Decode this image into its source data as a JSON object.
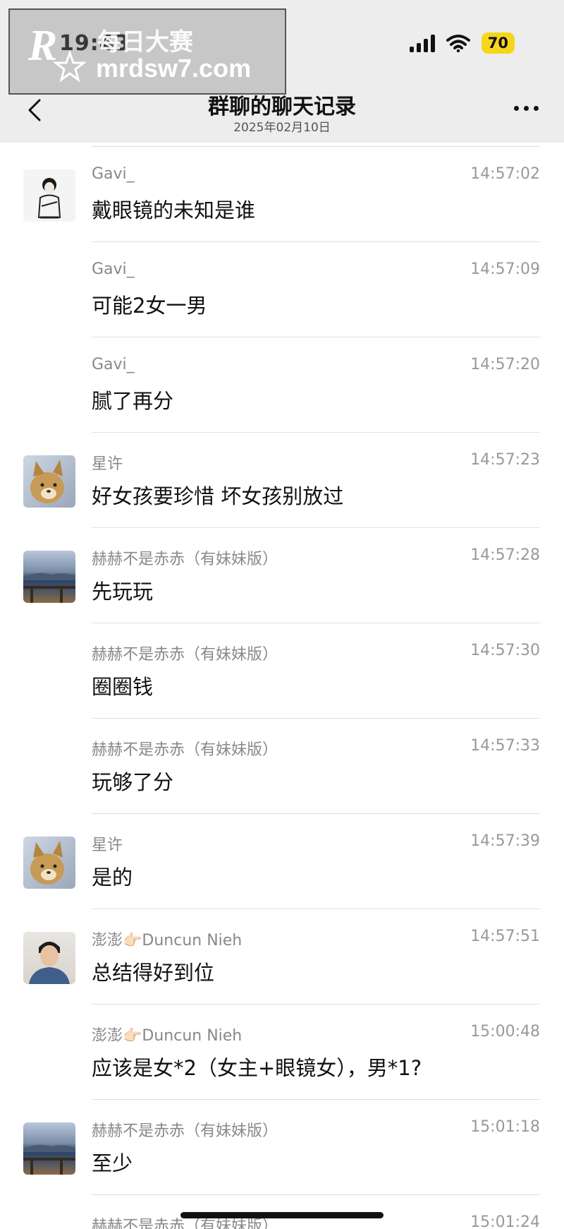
{
  "status_bar": {
    "time": "19:43",
    "battery": "70"
  },
  "watermark": {
    "logo": "R",
    "line1": "每日大赛",
    "line2": "mrdsw7.com"
  },
  "nav": {
    "title": "群聊的聊天记录",
    "subtitle": "2025年02月10日"
  },
  "messages": [
    {
      "avatar": "gavi",
      "sender": "Gavi_",
      "time": "14:57:02",
      "text": "戴眼镜的未知是谁"
    },
    {
      "avatar": "",
      "sender": "Gavi_",
      "time": "14:57:09",
      "text": "可能2女一男"
    },
    {
      "avatar": "",
      "sender": "Gavi_",
      "time": "14:57:20",
      "text": "腻了再分"
    },
    {
      "avatar": "dog",
      "sender": "星许",
      "time": "14:57:23",
      "text": "好女孩要珍惜 坏女孩别放过"
    },
    {
      "avatar": "lake",
      "sender": "赫赫不是赤赤（有妹妹版）",
      "time": "14:57:28",
      "text": "先玩玩"
    },
    {
      "avatar": "",
      "sender": "赫赫不是赤赤（有妹妹版）",
      "time": "14:57:30",
      "text": "圈圈钱"
    },
    {
      "avatar": "",
      "sender": "赫赫不是赤赤（有妹妹版）",
      "time": "14:57:33",
      "text": "玩够了分"
    },
    {
      "avatar": "dog",
      "sender": "星许",
      "time": "14:57:39",
      "text": "是的"
    },
    {
      "avatar": "man",
      "sender": "澎澎👉🏻Duncun Nieh",
      "time": "14:57:51",
      "text": "总结得好到位"
    },
    {
      "avatar": "",
      "sender": "澎澎👉🏻Duncun Nieh",
      "time": "15:00:48",
      "text": "应该是女*2（女主+眼镜女），男*1?"
    },
    {
      "avatar": "lake",
      "sender": "赫赫不是赤赤（有妹妹版）",
      "time": "15:01:18",
      "text": "至少"
    },
    {
      "avatar": "",
      "sender": "赫赫不是赤赤（有妹妹版）",
      "time": "15:01:24",
      "text": ""
    }
  ]
}
